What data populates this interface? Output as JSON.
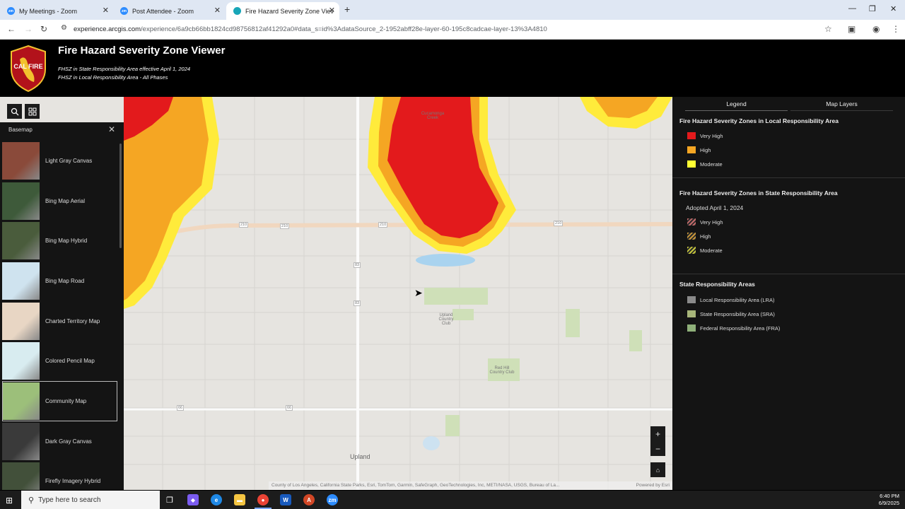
{
  "browser": {
    "tabs": [
      {
        "title": "My Meetings - Zoom",
        "icon": "zoom-icon",
        "active": false
      },
      {
        "title": "Post Attendee - Zoom",
        "icon": "zoom-icon",
        "active": false
      },
      {
        "title": "Fire Hazard Severity Zone Viev",
        "icon": "arcgis-icon",
        "active": true
      }
    ],
    "url_host": "experience.arcgis.com",
    "url_path": "/experience/6a9cb66bb1824cd98756812af41292a0#data_s=id%3AdataSource_2-1952abff28e-layer-60-195c8cadcae-layer-13%3A4810"
  },
  "app": {
    "logo_text": "CAL FIRE",
    "title": "Fire Hazard Severity Zone Viewer",
    "subtitle1": "FHSZ in State Responsibility Area effective April 1, 2024",
    "subtitle2": "FHSZ in Local Responsibility Area - All Phases"
  },
  "basemap": {
    "title": "Basemap",
    "items": [
      {
        "label": "Light Gray Canvas",
        "thumb": "#8a4a3a",
        "selected": false
      },
      {
        "label": "Bing Map Aerial",
        "thumb": "#3e5a3a",
        "selected": false
      },
      {
        "label": "Bing Map Hybrid",
        "thumb": "#4a5c3c",
        "selected": false
      },
      {
        "label": "Bing Map Road",
        "thumb": "#cfe3ef",
        "selected": false
      },
      {
        "label": "Charted Territory Map",
        "thumb": "#e8d6c4",
        "selected": false
      },
      {
        "label": "Colored Pencil Map",
        "thumb": "#d8ecf0",
        "selected": false
      },
      {
        "label": "Community Map",
        "thumb": "#9cbf7a",
        "selected": true
      },
      {
        "label": "Dark Gray Canvas",
        "thumb": "#3a3a3a",
        "selected": false
      },
      {
        "label": "Firefly Imagery Hybrid",
        "thumb": "#42503a",
        "selected": false
      }
    ]
  },
  "map": {
    "labels": {
      "creek": "Cucamonga Creek",
      "upland": "Upland",
      "rh_country_club": "Red Hill Country Club",
      "upland_country_club": "Upland Country Club"
    },
    "highways": [
      "210",
      "210",
      "210",
      "210",
      "83",
      "83",
      "66",
      "66"
    ],
    "attribution": "County of Los Angeles, California State Parks, Esri, TomTom, Garmin, SafeGraph, GeoTechnologies, Inc, METI/NASA, USGS, Bureau of La...",
    "powered_by": "Powered by Esri"
  },
  "legend_panel": {
    "tabs": [
      "Legend",
      "Map Layers"
    ],
    "lra": {
      "heading": "Fire Hazard Severity Zones in Local Responsibility Area",
      "items": [
        {
          "label": "Very High",
          "color": "#e31a1c"
        },
        {
          "label": "High",
          "color": "#f5a623"
        },
        {
          "label": "Moderate",
          "color": "#ffff33"
        }
      ]
    },
    "sra": {
      "heading": "Fire Hazard Severity Zones in State Responsibility Area",
      "adopted": "Adopted April 1, 2024",
      "items": [
        {
          "label": "Very High",
          "color": "#c46a6a"
        },
        {
          "label": "High",
          "color": "#c8963a"
        },
        {
          "label": "Moderate",
          "color": "#c4c43a"
        }
      ]
    },
    "resp": {
      "heading": "State Responsibility Areas",
      "items": [
        {
          "label": "Local Responsibility Area (LRA)",
          "color": "#8a8a8a"
        },
        {
          "label": "State Responsibility Area (SRA)",
          "color": "#a8b67a"
        },
        {
          "label": "Federal Responsibility Area (FRA)",
          "color": "#8fb07a"
        }
      ]
    }
  },
  "taskbar": {
    "search_placeholder": "Type here to search",
    "time": "6:40 PM",
    "date": "6/9/2025"
  }
}
